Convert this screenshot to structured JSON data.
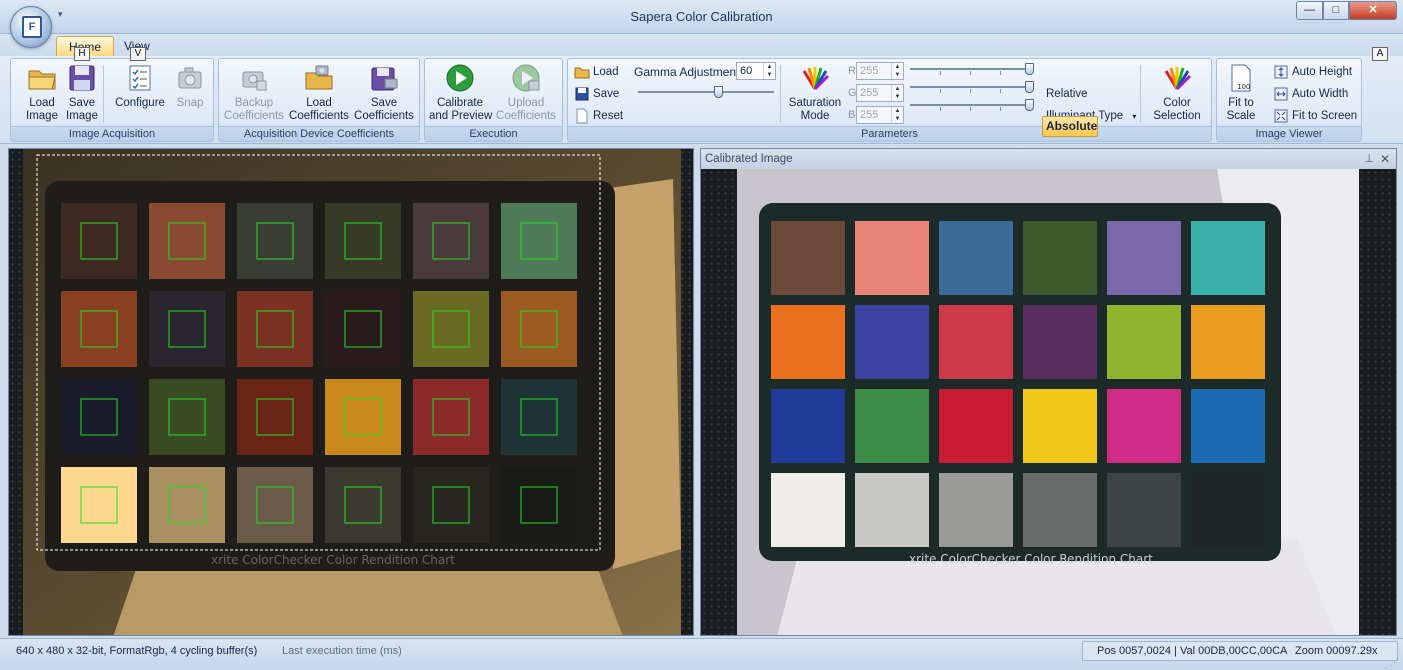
{
  "window": {
    "title": "Sapera Color Calibration",
    "orb_letter": "F",
    "qat_caret": "▾",
    "min": "—",
    "max": "□",
    "close": "✕"
  },
  "tabs": [
    {
      "label": "Home",
      "keytip": "H"
    },
    {
      "label": "View",
      "keytip": "V"
    }
  ],
  "help": {
    "glyph": "?",
    "keytip": "A",
    "caret": "▾"
  },
  "ribbon": {
    "image_acquisition": {
      "label": "Image Acquisition",
      "load_image": "Load\nImage",
      "save_image": "Save\nImage",
      "configure": "Configure",
      "snap": "Snap"
    },
    "device_coefficients": {
      "label": "Acquisition Device Coefficients",
      "backup": "Backup\nCoefficients",
      "load": "Load\nCoefficients",
      "save": "Save\nCoefficients"
    },
    "execution": {
      "label": "Execution",
      "calibrate": "Calibrate\nand Preview",
      "upload": "Upload\nCoefficients"
    },
    "parameters": {
      "label": "Parameters",
      "load": "Load",
      "save": "Save",
      "reset": "Reset",
      "gamma_label": "Gamma Adjustment",
      "gamma_value": "60",
      "gamma_fraction": 0.6,
      "saturation_mode": "Saturation\nMode",
      "r_label": "R",
      "r_value": "255",
      "g_label": "G",
      "g_value": "255",
      "b_label": "B",
      "b_value": "255",
      "absolute": "Absolute",
      "relative": "Relative",
      "illuminant_type": "Illuminant Type",
      "color_selection": "Color\nSelection"
    },
    "image_viewer": {
      "label": "Image Viewer",
      "fit_to_scale": "Fit to\nScale",
      "auto_height": "Auto Height",
      "auto_width": "Auto Width",
      "fit_to_screen": "Fit to Screen"
    }
  },
  "panes": {
    "calibrated_title": "Calibrated Image",
    "pin_glyph": "⊥",
    "close_glyph": "✕",
    "chart_caption": "xrite ColorChecker Color Rendition Chart"
  },
  "colors": {
    "raw_patches": [
      "#3e2a22",
      "#8a4a32",
      "#3a3d36",
      "#363a26",
      "#4a3a3c",
      "#4f7a58",
      "#8a4020",
      "#2a2630",
      "#7a3022",
      "#2a1a1e",
      "#6a6a24",
      "#9a5a20",
      "#1a1c2c",
      "#3a4a22",
      "#6a2418",
      "#c8881e",
      "#8a2a2a",
      "#1e3436",
      "#ffd890",
      "#a89060",
      "#6a5c48",
      "#3c3a30",
      "#26261e",
      "#1a1a16"
    ],
    "calibrated_patches": [
      "#6b4a3c",
      "#e88478",
      "#3a6a96",
      "#3e5a2c",
      "#7a68aa",
      "#39b0a8",
      "#ea7020",
      "#3a44a0",
      "#d03a4a",
      "#582e5e",
      "#90b430",
      "#e89c20",
      "#1e3c98",
      "#3c8c48",
      "#c81c34",
      "#f0c81a",
      "#d02c88",
      "#1c6ab0",
      "#f0eeea",
      "#c8c8c4",
      "#9a9a98",
      "#6a6c6c",
      "#3e4444",
      "#202628"
    ],
    "selection_box": "#22dd22",
    "accent": "#ffc64c"
  },
  "status": {
    "format": "640 x 480 x 32-bit, FormatRgb, 4 cycling buffer(s)",
    "exec_time": "Last execution time (ms)",
    "position": "Pos 0057,0024 | Val 00DB,00CC,00CA",
    "zoom": "Zoom 00097.29x"
  }
}
